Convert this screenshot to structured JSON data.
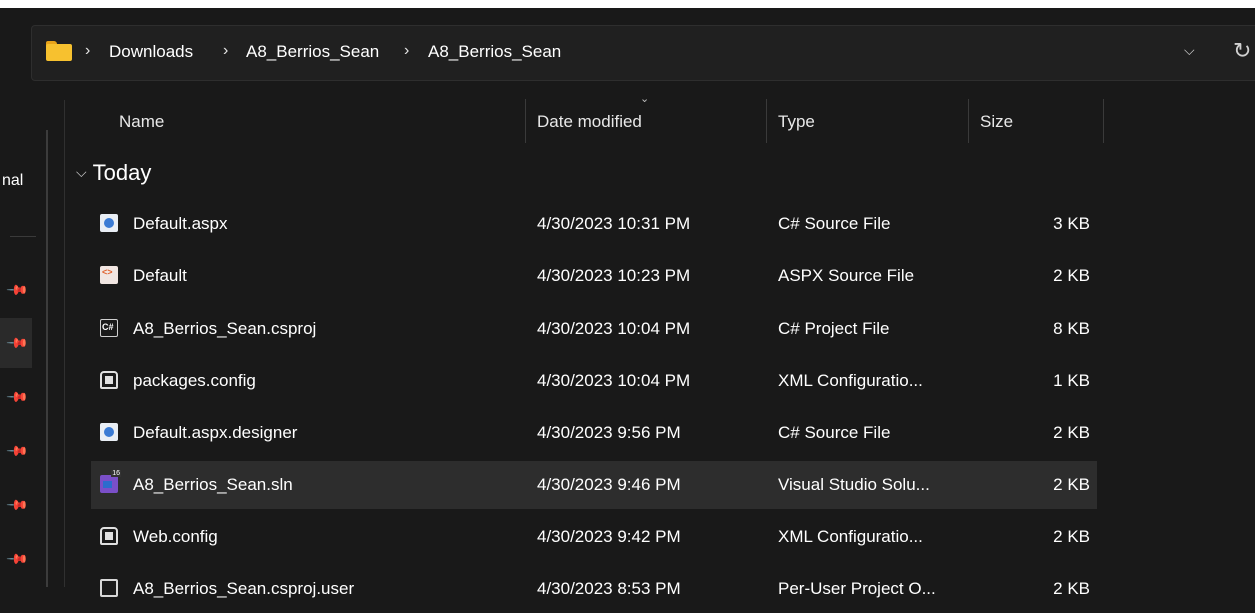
{
  "breadcrumb": {
    "items": [
      "Downloads",
      "A8_Berrios_Sean",
      "A8_Berrios_Sean"
    ],
    "separator": "›"
  },
  "address_bar": {
    "dropdown_glyph": "⌵",
    "refresh_glyph": "↻"
  },
  "nav": {
    "clipped_label": "nal",
    "pin_glyph": "📌"
  },
  "columns": {
    "name": "Name",
    "date": "Date modified",
    "type": "Type",
    "size": "Size",
    "sort_glyph": "⌄"
  },
  "group": {
    "label": "Today",
    "chevron": "⌵"
  },
  "files": [
    {
      "name": "Default.aspx",
      "date": "4/30/2023 10:31 PM",
      "type": "C# Source File",
      "size": "3 KB",
      "icon": "csharp-source-icon"
    },
    {
      "name": "Default",
      "date": "4/30/2023 10:23 PM",
      "type": "ASPX Source File",
      "size": "2 KB",
      "icon": "aspx-source-icon"
    },
    {
      "name": "A8_Berrios_Sean.csproj",
      "date": "4/30/2023 10:04 PM",
      "type": "C# Project File",
      "size": "8 KB",
      "icon": "csharp-project-icon"
    },
    {
      "name": "packages.config",
      "date": "4/30/2023 10:04 PM",
      "type": "XML Configuratio...",
      "size": "1 KB",
      "icon": "xml-config-icon"
    },
    {
      "name": "Default.aspx.designer",
      "date": "4/30/2023 9:56 PM",
      "type": "C# Source File",
      "size": "2 KB",
      "icon": "csharp-source-icon"
    },
    {
      "name": "A8_Berrios_Sean.sln",
      "date": "4/30/2023 9:46 PM",
      "type": "Visual Studio Solu...",
      "size": "2 KB",
      "icon": "visual-studio-solution-icon",
      "selected": true
    },
    {
      "name": "Web.config",
      "date": "4/30/2023 9:42 PM",
      "type": "XML Configuratio...",
      "size": "2 KB",
      "icon": "xml-config-icon"
    },
    {
      "name": "A8_Berrios_Sean.csproj.user",
      "date": "4/30/2023 8:53 PM",
      "type": "Per-User Project O...",
      "size": "2 KB",
      "icon": "user-project-options-icon"
    }
  ],
  "colors": {
    "background": "#191919",
    "selected_row": "#2d2d2d",
    "folder": "#f7c12f"
  }
}
